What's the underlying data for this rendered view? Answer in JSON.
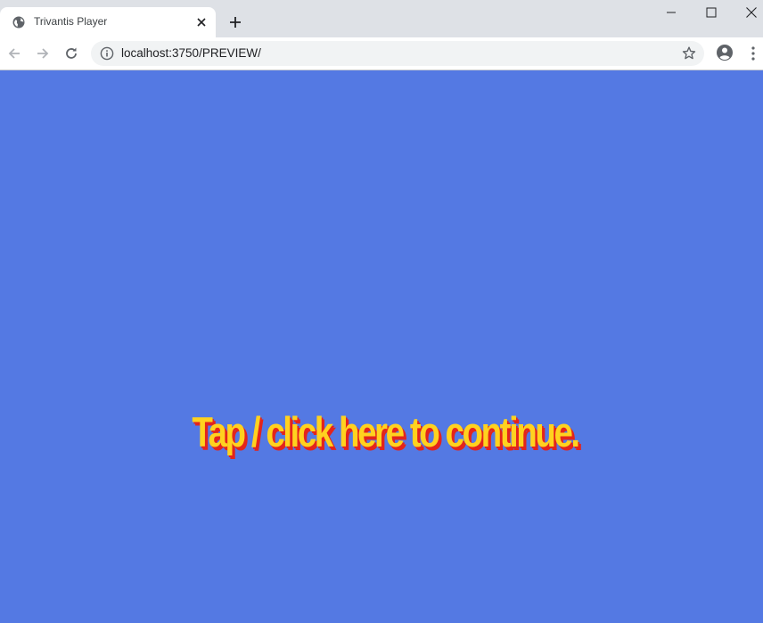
{
  "browser": {
    "tab": {
      "title": "Trivantis Player",
      "favicon": "globe-icon"
    },
    "address_bar": {
      "url": "localhost:3750/PREVIEW/"
    },
    "icons": {
      "back": "arrow-left-icon",
      "forward": "arrow-right-icon",
      "reload": "reload-icon",
      "info": "info-icon",
      "bookmark": "star-icon",
      "profile": "account-circle-icon",
      "menu": "kebab-menu-icon",
      "new_tab": "plus-icon",
      "minimize": "minimize-icon",
      "maximize": "maximize-icon",
      "close": "close-icon"
    }
  },
  "content": {
    "background_color": "#5479e3",
    "continue_prompt": "Tap / click here to continue.",
    "prompt_color": "#ffd21f",
    "prompt_shadow_color": "#e3241c"
  }
}
